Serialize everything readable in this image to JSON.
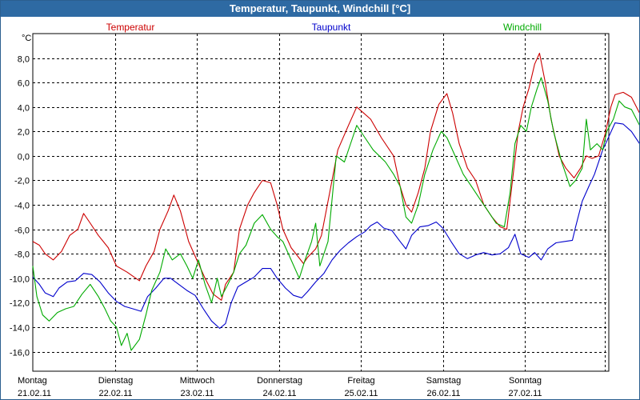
{
  "window": {
    "title": "Temperatur, Taupunkt, Windchill [°C]"
  },
  "chart_data": {
    "type": "line",
    "title": "Temperatur, Taupunkt, Windchill [°C]",
    "ylabel": "°C",
    "ylim": [
      -17.6,
      10.0
    ],
    "yticks": [
      "8,0",
      "6,0",
      "4,0",
      "2,0",
      "0,0",
      "-2,0",
      "-4,0",
      "-6,0",
      "-8,0",
      "-10,0",
      "-12,0",
      "-14,0",
      "-16,0"
    ],
    "ytick_values": [
      8,
      6,
      4,
      2,
      0,
      -2,
      -4,
      -6,
      -8,
      -10,
      -12,
      -14,
      -16
    ],
    "xlim": [
      0,
      7.02
    ],
    "x_categories": [
      {
        "day": "Montag",
        "date": "21.02.11"
      },
      {
        "day": "Dienstag",
        "date": "22.02.11"
      },
      {
        "day": "Mittwoch",
        "date": "23.02.11"
      },
      {
        "day": "Donnerstag",
        "date": "24.02.11"
      },
      {
        "day": "Freitag",
        "date": "25.02.11"
      },
      {
        "day": "Samstag",
        "date": "26.02.11"
      },
      {
        "day": "Sonntag",
        "date": "27.02.11"
      }
    ],
    "grid": true,
    "legend_position": "top",
    "series": [
      {
        "name": "Temperatur",
        "color": "#cc0000",
        "points": [
          [
            0,
            -7
          ],
          [
            0.08,
            -7.3
          ],
          [
            0.15,
            -8
          ],
          [
            0.25,
            -8.5
          ],
          [
            0.35,
            -7.8
          ],
          [
            0.45,
            -6.5
          ],
          [
            0.55,
            -6
          ],
          [
            0.62,
            -4.7
          ],
          [
            0.7,
            -5.5
          ],
          [
            0.8,
            -6.5
          ],
          [
            0.92,
            -7.5
          ],
          [
            1.02,
            -9
          ],
          [
            1.15,
            -9.5
          ],
          [
            1.3,
            -10.2
          ],
          [
            1.38,
            -9
          ],
          [
            1.48,
            -7.8
          ],
          [
            1.55,
            -6
          ],
          [
            1.65,
            -4.5
          ],
          [
            1.72,
            -3.2
          ],
          [
            1.8,
            -4.5
          ],
          [
            1.9,
            -7
          ],
          [
            2.0,
            -8.5
          ],
          [
            2.1,
            -10
          ],
          [
            2.2,
            -11.3
          ],
          [
            2.3,
            -11.8
          ],
          [
            2.35,
            -10.5
          ],
          [
            2.45,
            -9.5
          ],
          [
            2.52,
            -6
          ],
          [
            2.62,
            -4
          ],
          [
            2.7,
            -3
          ],
          [
            2.8,
            -2
          ],
          [
            2.9,
            -2.2
          ],
          [
            2.98,
            -4
          ],
          [
            3.05,
            -6
          ],
          [
            3.15,
            -7.5
          ],
          [
            3.3,
            -8.8
          ],
          [
            3.35,
            -8.3
          ],
          [
            3.45,
            -7.6
          ],
          [
            3.52,
            -6.5
          ],
          [
            3.62,
            -3
          ],
          [
            3.72,
            0.5
          ],
          [
            3.85,
            2.5
          ],
          [
            3.95,
            4
          ],
          [
            4.02,
            3.6
          ],
          [
            4.12,
            3
          ],
          [
            4.25,
            1.5
          ],
          [
            4.4,
            0
          ],
          [
            4.48,
            -2.5
          ],
          [
            4.55,
            -4
          ],
          [
            4.62,
            -4.6
          ],
          [
            4.7,
            -3
          ],
          [
            4.78,
            -1
          ],
          [
            4.85,
            2
          ],
          [
            4.95,
            4.2
          ],
          [
            5.05,
            5.1
          ],
          [
            5.12,
            3.5
          ],
          [
            5.2,
            1
          ],
          [
            5.3,
            -1
          ],
          [
            5.4,
            -2
          ],
          [
            5.5,
            -4
          ],
          [
            5.6,
            -5
          ],
          [
            5.7,
            -5.8
          ],
          [
            5.78,
            -6
          ],
          [
            5.85,
            -2
          ],
          [
            5.92,
            2
          ],
          [
            5.98,
            4
          ],
          [
            6.05,
            5.5
          ],
          [
            6.12,
            7.5
          ],
          [
            6.18,
            8.4
          ],
          [
            6.25,
            6
          ],
          [
            6.32,
            3
          ],
          [
            6.42,
            0
          ],
          [
            6.5,
            -1
          ],
          [
            6.6,
            -1.8
          ],
          [
            6.68,
            -1
          ],
          [
            6.75,
            0
          ],
          [
            6.82,
            -0.2
          ],
          [
            6.9,
            0
          ],
          [
            6.98,
            1.8
          ],
          [
            7.05,
            4
          ],
          [
            7.1,
            5
          ],
          [
            7.2,
            5.2
          ],
          [
            7.3,
            4.8
          ],
          [
            7.4,
            3.5
          ],
          [
            7.48,
            2
          ]
        ]
      },
      {
        "name": "Taupunkt",
        "color": "#0000cc",
        "points": [
          [
            0,
            -9.9
          ],
          [
            0.08,
            -10.5
          ],
          [
            0.15,
            -11.2
          ],
          [
            0.25,
            -11.5
          ],
          [
            0.32,
            -10.8
          ],
          [
            0.42,
            -10.3
          ],
          [
            0.52,
            -10.2
          ],
          [
            0.62,
            -9.6
          ],
          [
            0.72,
            -9.7
          ],
          [
            0.82,
            -10.3
          ],
          [
            0.92,
            -11.2
          ],
          [
            1.02,
            -11.9
          ],
          [
            1.12,
            -12.3
          ],
          [
            1.22,
            -12.5
          ],
          [
            1.32,
            -12.7
          ],
          [
            1.4,
            -11.5
          ],
          [
            1.5,
            -10.8
          ],
          [
            1.6,
            -10
          ],
          [
            1.68,
            -10
          ],
          [
            1.78,
            -10.5
          ],
          [
            1.88,
            -11
          ],
          [
            1.98,
            -11.4
          ],
          [
            2.08,
            -12.5
          ],
          [
            2.18,
            -13.5
          ],
          [
            2.28,
            -14.1
          ],
          [
            2.35,
            -13.7
          ],
          [
            2.42,
            -12
          ],
          [
            2.5,
            -10.7
          ],
          [
            2.6,
            -10.3
          ],
          [
            2.7,
            -9.9
          ],
          [
            2.8,
            -9.2
          ],
          [
            2.9,
            -9.2
          ],
          [
            2.98,
            -10
          ],
          [
            3.08,
            -10.8
          ],
          [
            3.18,
            -11.4
          ],
          [
            3.28,
            -11.6
          ],
          [
            3.35,
            -11.1
          ],
          [
            3.45,
            -10.3
          ],
          [
            3.55,
            -9.6
          ],
          [
            3.65,
            -8.5
          ],
          [
            3.75,
            -7.7
          ],
          [
            3.85,
            -7.1
          ],
          [
            3.95,
            -6.6
          ],
          [
            4.05,
            -6.2
          ],
          [
            4.12,
            -5.7
          ],
          [
            4.2,
            -5.4
          ],
          [
            4.28,
            -5.9
          ],
          [
            4.38,
            -6.1
          ],
          [
            4.48,
            -7
          ],
          [
            4.55,
            -7.6
          ],
          [
            4.62,
            -6.5
          ],
          [
            4.72,
            -5.8
          ],
          [
            4.82,
            -5.7
          ],
          [
            4.92,
            -5.4
          ],
          [
            5.0,
            -5.9
          ],
          [
            5.1,
            -7
          ],
          [
            5.2,
            -8
          ],
          [
            5.3,
            -8.4
          ],
          [
            5.4,
            -8.1
          ],
          [
            5.5,
            -7.9
          ],
          [
            5.6,
            -8.1
          ],
          [
            5.7,
            -8
          ],
          [
            5.8,
            -7.5
          ],
          [
            5.88,
            -6.4
          ],
          [
            5.95,
            -8
          ],
          [
            6.05,
            -8.3
          ],
          [
            6.12,
            -7.9
          ],
          [
            6.2,
            -8.5
          ],
          [
            6.28,
            -7.6
          ],
          [
            6.38,
            -7.1
          ],
          [
            6.48,
            -7
          ],
          [
            6.58,
            -6.9
          ],
          [
            6.62,
            -5.8
          ],
          [
            6.7,
            -3.7
          ],
          [
            6.78,
            -2.5
          ],
          [
            6.85,
            -1.5
          ],
          [
            6.95,
            0.5
          ],
          [
            7.02,
            1.5
          ],
          [
            7.1,
            2.7
          ],
          [
            7.2,
            2.6
          ],
          [
            7.3,
            2
          ],
          [
            7.4,
            1
          ],
          [
            7.48,
            0.2
          ]
        ]
      },
      {
        "name": "Windchill",
        "color": "#00aa00",
        "points": [
          [
            0,
            -9
          ],
          [
            0.05,
            -11.5
          ],
          [
            0.12,
            -13
          ],
          [
            0.2,
            -13.5
          ],
          [
            0.3,
            -12.8
          ],
          [
            0.4,
            -12.5
          ],
          [
            0.5,
            -12.3
          ],
          [
            0.6,
            -11.3
          ],
          [
            0.7,
            -10.5
          ],
          [
            0.8,
            -11.5
          ],
          [
            0.88,
            -12.5
          ],
          [
            0.95,
            -13.5
          ],
          [
            1.02,
            -14
          ],
          [
            1.08,
            -15.5
          ],
          [
            1.15,
            -14.5
          ],
          [
            1.2,
            -15.9
          ],
          [
            1.3,
            -15
          ],
          [
            1.38,
            -13
          ],
          [
            1.45,
            -11
          ],
          [
            1.55,
            -9.5
          ],
          [
            1.62,
            -7.6
          ],
          [
            1.7,
            -8.5
          ],
          [
            1.8,
            -8
          ],
          [
            1.88,
            -9
          ],
          [
            1.95,
            -10
          ],
          [
            2.02,
            -8.5
          ],
          [
            2.1,
            -10.5
          ],
          [
            2.18,
            -12
          ],
          [
            2.25,
            -10
          ],
          [
            2.3,
            -11.5
          ],
          [
            2.38,
            -10.5
          ],
          [
            2.45,
            -9.5
          ],
          [
            2.52,
            -8
          ],
          [
            2.6,
            -7.3
          ],
          [
            2.7,
            -5.5
          ],
          [
            2.8,
            -4.8
          ],
          [
            2.9,
            -6
          ],
          [
            2.98,
            -6.6
          ],
          [
            3.05,
            -7
          ],
          [
            3.15,
            -8.5
          ],
          [
            3.25,
            -10
          ],
          [
            3.32,
            -8.5
          ],
          [
            3.4,
            -7
          ],
          [
            3.45,
            -5.5
          ],
          [
            3.5,
            -9
          ],
          [
            3.6,
            -7
          ],
          [
            3.7,
            0
          ],
          [
            3.8,
            -0.5
          ],
          [
            3.9,
            1.5
          ],
          [
            3.95,
            2.5
          ],
          [
            4.05,
            1.5
          ],
          [
            4.15,
            0.5
          ],
          [
            4.3,
            -0.5
          ],
          [
            4.4,
            -1.5
          ],
          [
            4.48,
            -2.5
          ],
          [
            4.55,
            -5
          ],
          [
            4.62,
            -5.5
          ],
          [
            4.7,
            -4
          ],
          [
            4.78,
            -1.5
          ],
          [
            4.88,
            0.5
          ],
          [
            4.98,
            2
          ],
          [
            5.05,
            1.5
          ],
          [
            5.15,
            0
          ],
          [
            5.25,
            -1.5
          ],
          [
            5.35,
            -2.5
          ],
          [
            5.45,
            -3.5
          ],
          [
            5.55,
            -4.5
          ],
          [
            5.65,
            -5.5
          ],
          [
            5.75,
            -5.8
          ],
          [
            5.82,
            -3
          ],
          [
            5.88,
            1
          ],
          [
            5.95,
            2.5
          ],
          [
            6.02,
            2
          ],
          [
            6.08,
            4
          ],
          [
            6.15,
            5.5
          ],
          [
            6.2,
            6.4
          ],
          [
            6.28,
            4.5
          ],
          [
            6.35,
            2
          ],
          [
            6.45,
            -0.5
          ],
          [
            6.55,
            -2.5
          ],
          [
            6.62,
            -2
          ],
          [
            6.7,
            -1
          ],
          [
            6.75,
            3
          ],
          [
            6.8,
            0.5
          ],
          [
            6.88,
            1
          ],
          [
            6.95,
            0.5
          ],
          [
            7.0,
            2
          ],
          [
            7.08,
            3
          ],
          [
            7.15,
            4.5
          ],
          [
            7.22,
            4
          ],
          [
            7.3,
            3.8
          ],
          [
            7.4,
            2.5
          ],
          [
            7.48,
            1.8
          ]
        ]
      }
    ]
  }
}
